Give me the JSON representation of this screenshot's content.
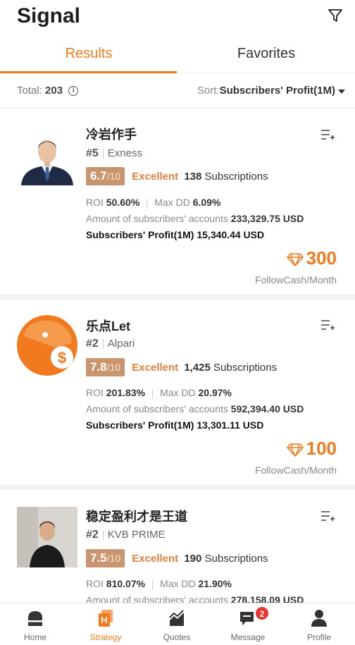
{
  "app": {
    "title": "Signal"
  },
  "tabs": [
    {
      "label": "Results",
      "active": true
    },
    {
      "label": "Favorites",
      "active": false
    }
  ],
  "summary": {
    "total_label": "Total:",
    "total_value": "203",
    "sort_label": "Sort:",
    "sort_value": "Subscribers' Profit(1M)"
  },
  "signals": [
    {
      "name": "冷岩作手",
      "rank": "#5",
      "broker": "Exness",
      "score": "6.7",
      "score_max": "/10",
      "grade": "Excellent",
      "subscriptions": "138",
      "subscriptions_label": "Subscriptions",
      "roi_label": "ROI",
      "roi": "50.60%",
      "maxdd_label": "Max DD",
      "maxdd": "6.09%",
      "accounts_label": "Amount of subscribers' accounts",
      "accounts_value": "233,329.75 USD",
      "profit_label": "Subscribers' Profit(1M)",
      "profit_value": "15,340.44 USD",
      "price": "300",
      "price_unit": "FollowCash/Month"
    },
    {
      "name": "乐点Let",
      "rank": "#2",
      "broker": "Alpari",
      "score": "7.8",
      "score_max": "/10",
      "grade": "Excellent",
      "subscriptions": "1,425",
      "subscriptions_label": "Subscriptions",
      "roi_label": "ROI",
      "roi": "201.83%",
      "maxdd_label": "Max DD",
      "maxdd": "20.97%",
      "accounts_label": "Amount of subscribers' accounts",
      "accounts_value": "592,394.40 USD",
      "profit_label": "Subscribers' Profit(1M)",
      "profit_value": "13,301.11 USD",
      "price": "100",
      "price_unit": "FollowCash/Month"
    },
    {
      "name": "稳定盈利才是王道",
      "rank": "#2",
      "broker": "KVB PRIME",
      "score": "7.5",
      "score_max": "/10",
      "grade": "Excellent",
      "subscriptions": "190",
      "subscriptions_label": "Subscriptions",
      "roi_label": "ROI",
      "roi": "810.07%",
      "maxdd_label": "Max DD",
      "maxdd": "21.90%",
      "accounts_label": "Amount of subscribers' accounts",
      "accounts_value": "278,158.09 USD"
    }
  ],
  "nav": [
    {
      "label": "Home",
      "icon": "home-icon",
      "active": false
    },
    {
      "label": "Strategy",
      "icon": "strategy-icon",
      "active": true
    },
    {
      "label": "Quotes",
      "icon": "quotes-icon",
      "active": false
    },
    {
      "label": "Message",
      "icon": "message-icon",
      "active": false,
      "badge": "2"
    },
    {
      "label": "Profile",
      "icon": "profile-icon",
      "active": false
    }
  ],
  "colors": {
    "accent": "#f07a1d",
    "score_bg": "#c9956e",
    "grade": "#e0823f",
    "badge": "#e8352f"
  }
}
